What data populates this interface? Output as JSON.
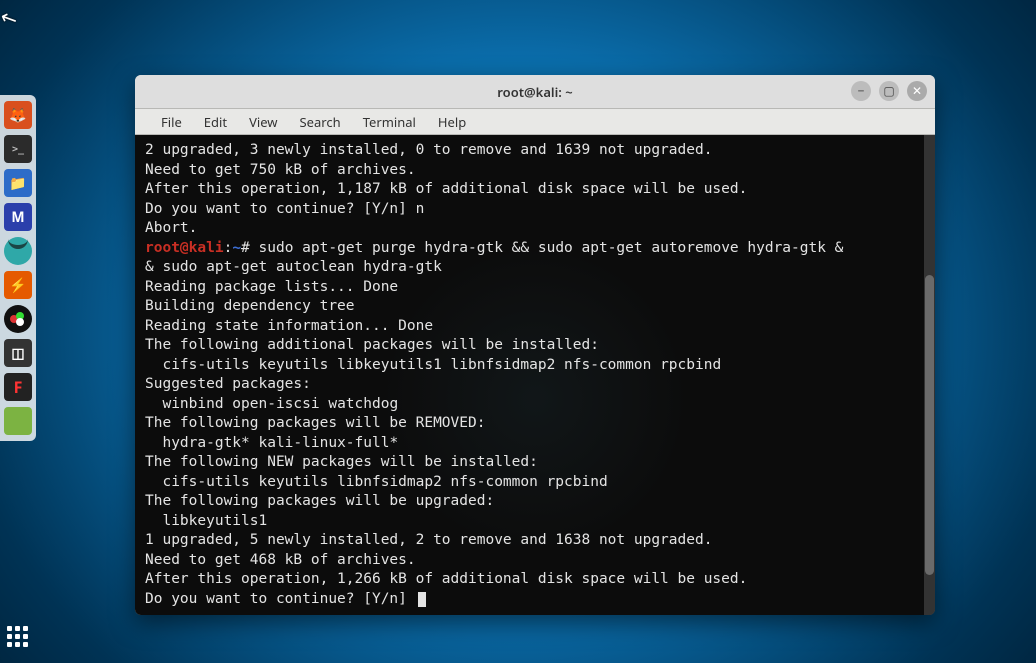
{
  "cursor_glyph": "↖",
  "dock": {
    "items": [
      {
        "name": "firefox-icon",
        "glyph": "🦊"
      },
      {
        "name": "terminal-icon",
        "glyph": ">_"
      },
      {
        "name": "files-icon",
        "glyph": "📁"
      },
      {
        "name": "metasploit-icon",
        "glyph": "M"
      },
      {
        "name": "armitage-icon",
        "glyph": ""
      },
      {
        "name": "zap-icon",
        "glyph": "⚡"
      },
      {
        "name": "obs-icon",
        "glyph": ""
      },
      {
        "name": "pattern-icon",
        "glyph": "◫"
      },
      {
        "name": "fscript-icon",
        "glyph": "F"
      },
      {
        "name": "notes-icon",
        "glyph": ""
      }
    ]
  },
  "window": {
    "title": "root@kali: ~",
    "controls": {
      "min": "−",
      "max": "▢",
      "close": "✕"
    },
    "menu": [
      "File",
      "Edit",
      "View",
      "Search",
      "Terminal",
      "Help"
    ]
  },
  "term": {
    "l01": "2 upgraded, 3 newly installed, 0 to remove and 1639 not upgraded.",
    "l02": "Need to get 750 kB of archives.",
    "l03": "After this operation, 1,187 kB of additional disk space will be used.",
    "l04": "Do you want to continue? [Y/n] n",
    "l05": "Abort.",
    "prompt_user": "root@kali",
    "prompt_sep": ":",
    "prompt_path": "~",
    "prompt_hash": "# ",
    "cmd_a": "sudo apt-get purge hydra-gtk && sudo apt-get autoremove hydra-gtk &",
    "cmd_b": "& sudo apt-get autoclean hydra-gtk",
    "l06": "Reading package lists... Done",
    "l07": "Building dependency tree",
    "l08": "Reading state information... Done",
    "l09": "The following additional packages will be installed:",
    "l10": "  cifs-utils keyutils libkeyutils1 libnfsidmap2 nfs-common rpcbind",
    "l11": "Suggested packages:",
    "l12": "  winbind open-iscsi watchdog",
    "l13": "The following packages will be REMOVED:",
    "l14": "  hydra-gtk* kali-linux-full*",
    "l15": "The following NEW packages will be installed:",
    "l16": "  cifs-utils keyutils libnfsidmap2 nfs-common rpcbind",
    "l17": "The following packages will be upgraded:",
    "l18": "  libkeyutils1",
    "l19": "1 upgraded, 5 newly installed, 2 to remove and 1638 not upgraded.",
    "l20": "Need to get 468 kB of archives.",
    "l21": "After this operation, 1,266 kB of additional disk space will be used.",
    "l22": "Do you want to continue? [Y/n] "
  }
}
